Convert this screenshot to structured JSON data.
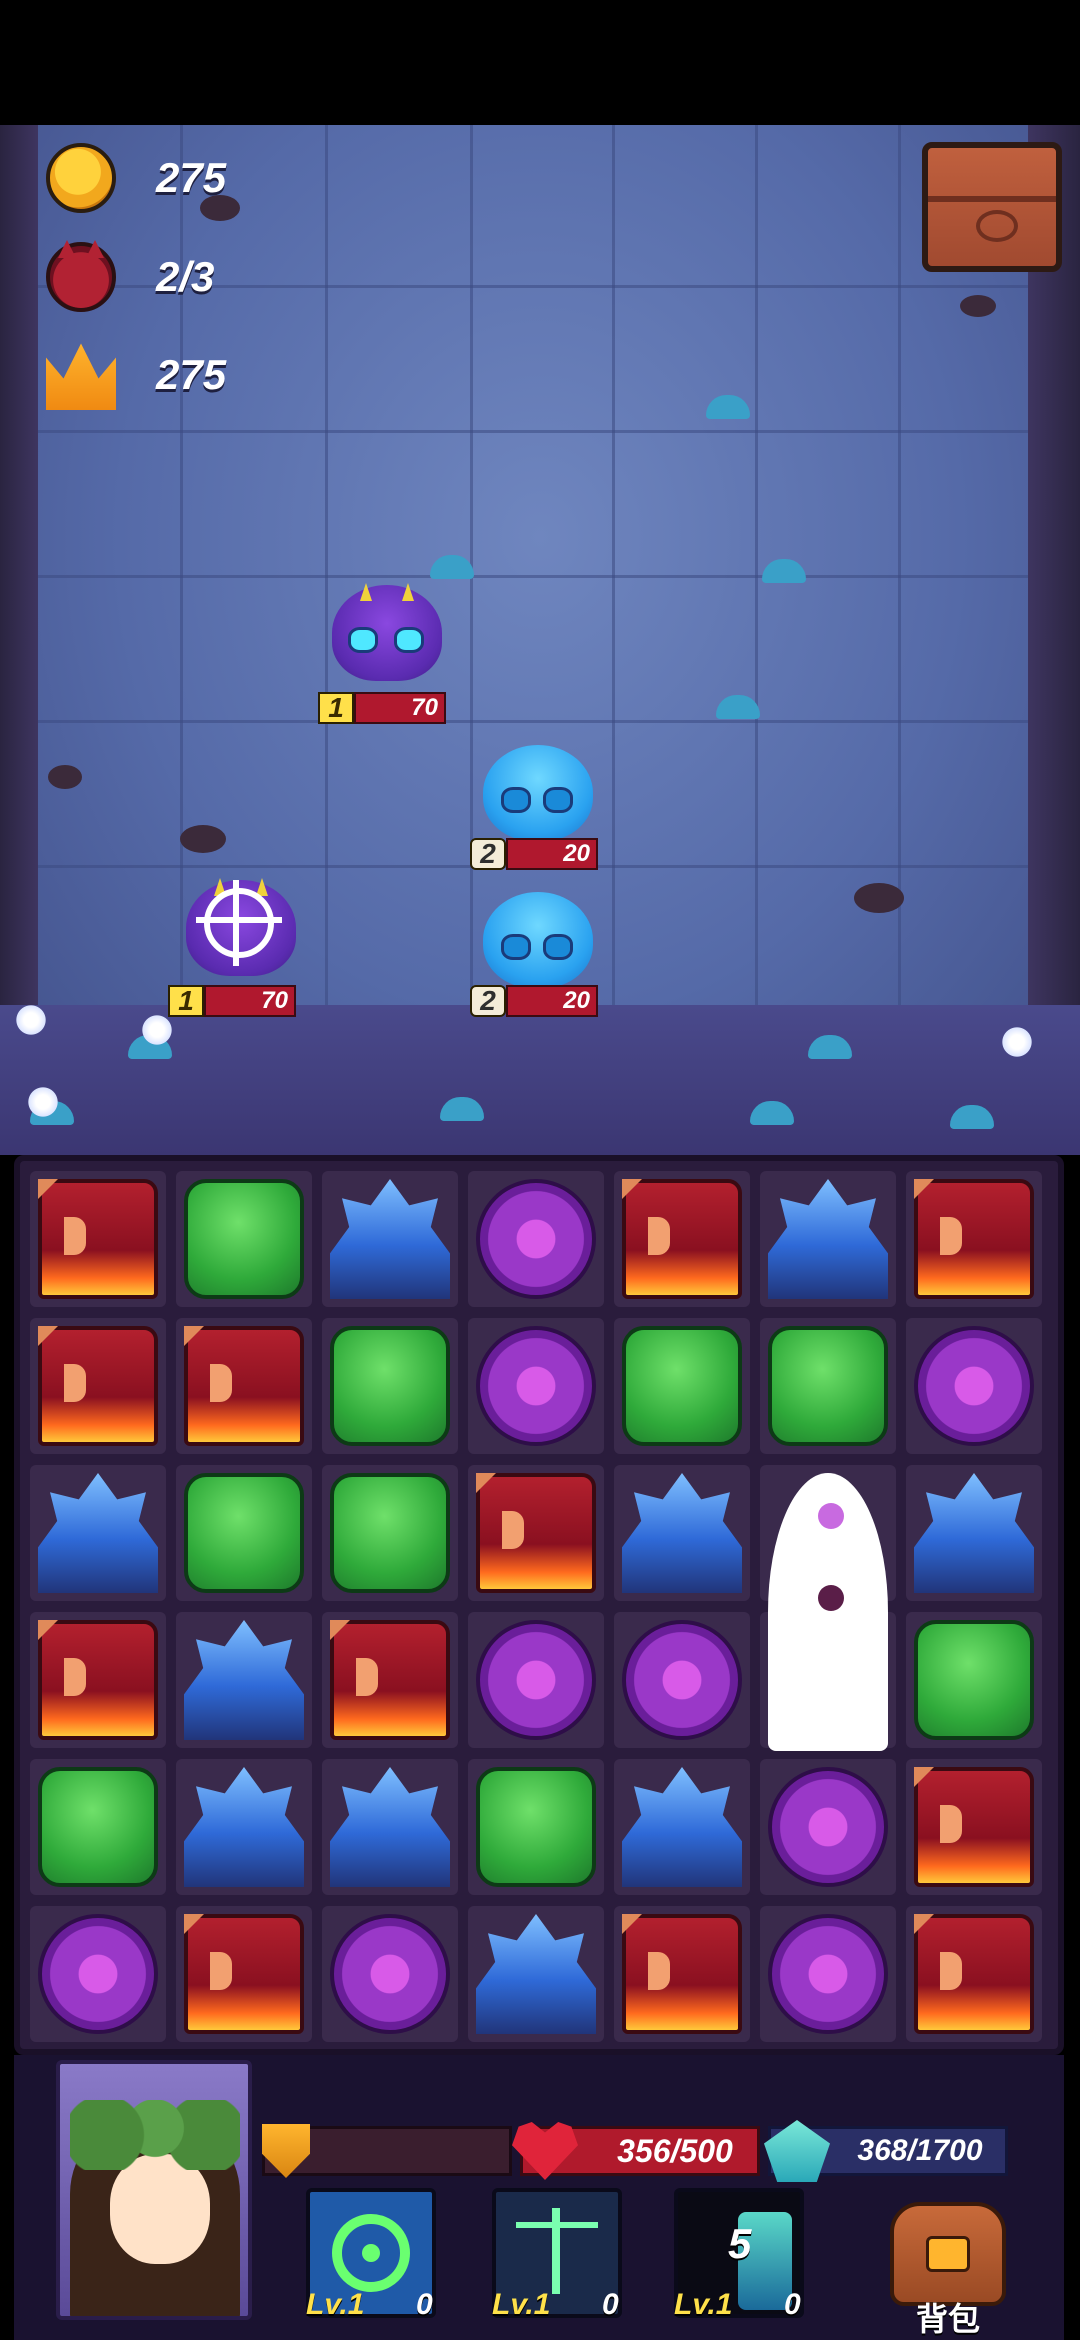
{
  "hud": {
    "coins": "275",
    "enemy_waves": "2/3",
    "crowns": "275"
  },
  "enemies": [
    {
      "type": "purple-beetle",
      "level": "1",
      "hp": "70",
      "targeted": false
    },
    {
      "type": "blue-slime",
      "level": "2",
      "hp": "20",
      "targeted": false
    },
    {
      "type": "purple-beetle",
      "level": "1",
      "hp": "70",
      "targeted": true
    },
    {
      "type": "blue-slime",
      "level": "2",
      "hp": "20",
      "targeted": false
    }
  ],
  "board": {
    "rows": 6,
    "cols": 7,
    "grid": [
      [
        "red",
        "green",
        "blue",
        "purple",
        "red",
        "blue",
        "red"
      ],
      [
        "red",
        "red",
        "green",
        "purple",
        "green",
        "green",
        "purple"
      ],
      [
        "blue",
        "green",
        "green",
        "red",
        "blue",
        "special",
        "blue"
      ],
      [
        "red",
        "blue",
        "red",
        "purple",
        "purple",
        "special",
        "green"
      ],
      [
        "green",
        "blue",
        "blue",
        "green",
        "blue",
        "purple",
        "red"
      ],
      [
        "purple",
        "red",
        "purple",
        "blue",
        "red",
        "purple",
        "red"
      ]
    ]
  },
  "player": {
    "hp_text": "356/500",
    "energy_text": "368/1700"
  },
  "skills": [
    {
      "name": "target-skill",
      "level": "Lv.1",
      "uses": "0",
      "count": ""
    },
    {
      "name": "scales-skill",
      "level": "Lv.1",
      "uses": "0",
      "count": ""
    },
    {
      "name": "crystal-skill",
      "level": "Lv.1",
      "uses": "0",
      "count": "5"
    }
  ],
  "backpack": {
    "label": "背包"
  },
  "colors": {
    "gem_red": "#b3202e",
    "gem_green": "#2faa3a",
    "gem_blue": "#2f6ad8",
    "gem_purple": "#9a38c8",
    "hp": "#b01a2c",
    "energy": "#2a2f66"
  }
}
